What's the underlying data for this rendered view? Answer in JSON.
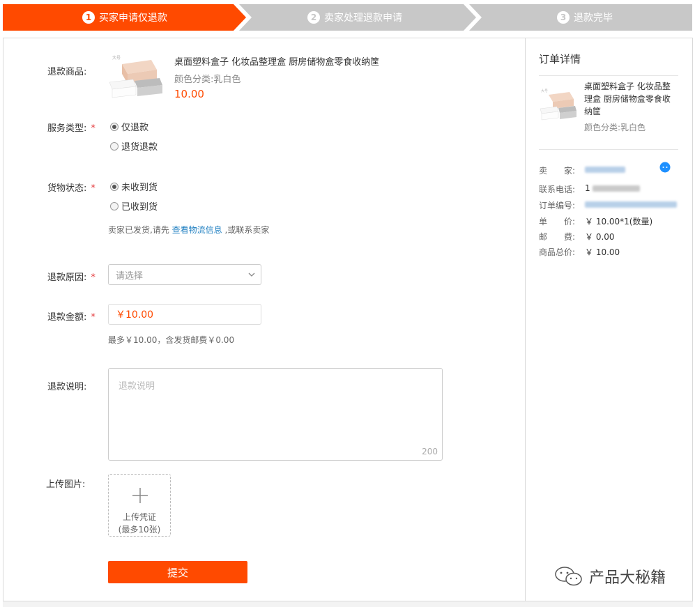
{
  "steps": [
    {
      "num": "1",
      "label": "买家申请仅退款",
      "active": true
    },
    {
      "num": "2",
      "label": "卖家处理退款申请",
      "active": false
    },
    {
      "num": "3",
      "label": "退款完毕",
      "active": false
    }
  ],
  "form": {
    "product_label": "退款商品:",
    "product": {
      "title": "桌面塑料盒子 化妆品整理盒 厨房储物盒零食收纳筐",
      "variant": "颜色分类:乳白色",
      "price": "10.00"
    },
    "service_type": {
      "label": "服务类型:",
      "required_mark": "*",
      "options": [
        "仅退款",
        "退货退款"
      ],
      "selected": 0
    },
    "goods_status": {
      "label": "货物状态:",
      "required_mark": "*",
      "options": [
        "未收到货",
        "已收到货"
      ],
      "selected": 0,
      "hint_before": "卖家已发货,请先",
      "hint_link": "查看物流信息",
      "hint_after": ",或联系卖家"
    },
    "reason": {
      "label": "退款原因:",
      "required_mark": "*",
      "placeholder": "请选择"
    },
    "amount": {
      "label": "退款金额:",
      "required_mark": "*",
      "value": "￥10.00",
      "hint": "最多￥10.00，含发货邮费￥0.00"
    },
    "description": {
      "label": "退款说明:",
      "placeholder": "退款说明",
      "max_chars": "200"
    },
    "upload": {
      "label": "上传图片:",
      "button_line1": "上传凭证",
      "button_line2": "(最多10张)"
    },
    "submit_label": "提交"
  },
  "order_detail": {
    "title": "订单详情",
    "product_title": "桌面塑料盒子 化妆品整理盒 厨房储物盒零食收纳筐",
    "product_variant": "颜色分类:乳白色",
    "seller_label": "卖　　家:",
    "phone_label": "联系电话:",
    "phone_visible": "1",
    "order_no_label": "订单编号:",
    "unit_price_label": "单　　价:",
    "unit_price_value": "￥ 10.00*1(数量)",
    "postage_label": "邮　　费:",
    "postage_value": "￥ 0.00",
    "total_label": "商品总价:",
    "total_value": "￥ 10.00"
  },
  "watermark": "产品大秘籍",
  "colors": {
    "accent": "#ff4a00",
    "step_inactive": "#c8c8c8",
    "link": "#1f7fc1",
    "required": "#e4393c"
  }
}
